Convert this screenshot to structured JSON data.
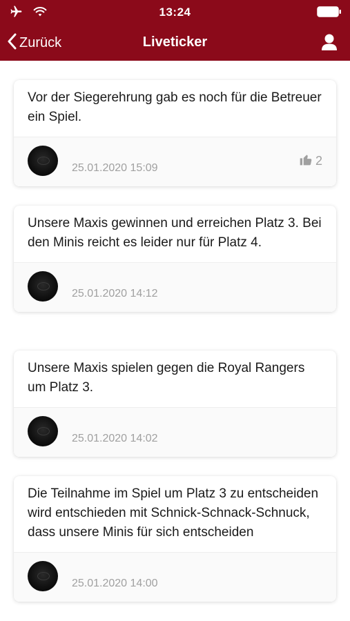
{
  "status_bar": {
    "time": "13:24",
    "icons": [
      "airplane-icon",
      "wifi-icon",
      "battery-icon"
    ]
  },
  "nav": {
    "back_label": "Zurück",
    "title": "Liveticker",
    "profile_icon": "profile-icon"
  },
  "colors": {
    "brand": "#8b0a1a",
    "timestamp": "#a0a0a0"
  },
  "posts": [
    {
      "text": "Vor der Siegerehrung gab es noch für die Betreuer ein Spiel.",
      "timestamp": "25.01.2020 15:09",
      "likes": "2"
    },
    {
      "text": "Unsere Maxis gewinnen und erreichen Platz 3. Bei den Minis reicht es leider nur für Platz 4.",
      "timestamp": "25.01.2020 14:12"
    },
    {
      "text": "Unsere Maxis spielen gegen die Royal Rangers um Platz 3.",
      "timestamp": "25.01.2020 14:02"
    },
    {
      "text": "Die Teilnahme im Spiel um Platz 3 zu entscheiden wird entschieden mit Schnick-Schnack-Schnuck, dass unsere Minis für sich entscheiden",
      "timestamp": "25.01.2020 14:00"
    }
  ]
}
